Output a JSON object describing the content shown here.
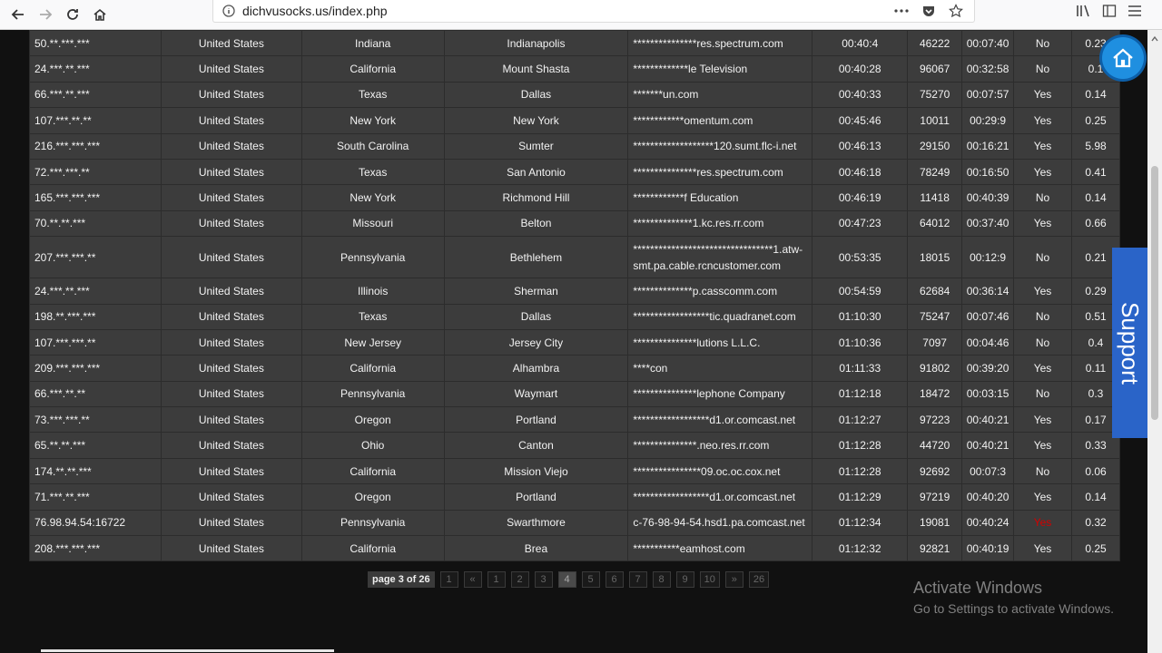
{
  "browser": {
    "url": "dichvusocks.us/index.php"
  },
  "rows": [
    [
      "50.**.***.***",
      "United States",
      "Indiana",
      "Indianapolis",
      "***************res.spectrum.com",
      "00:40:4",
      "46222",
      "00:07:40",
      "No",
      "0.23"
    ],
    [
      "24.***.**.***",
      "United States",
      "California",
      "Mount Shasta",
      "*************le Television",
      "00:40:28",
      "96067",
      "00:32:58",
      "No",
      "0.1"
    ],
    [
      "66.***.**.***",
      "United States",
      "Texas",
      "Dallas",
      "*******un.com",
      "00:40:33",
      "75270",
      "00:07:57",
      "Yes",
      "0.14"
    ],
    [
      "107.***.**.**",
      "United States",
      "New York",
      "New York",
      "************omentum.com",
      "00:45:46",
      "10011",
      "00:29:9",
      "Yes",
      "0.25"
    ],
    [
      "216.***.***.***",
      "United States",
      "South Carolina",
      "Sumter",
      "*******************120.sumt.flc-i.net",
      "00:46:13",
      "29150",
      "00:16:21",
      "Yes",
      "5.98"
    ],
    [
      "72.***.***.**",
      "United States",
      "Texas",
      "San Antonio",
      "***************res.spectrum.com",
      "00:46:18",
      "78249",
      "00:16:50",
      "Yes",
      "0.41"
    ],
    [
      "165.***.***.***",
      "United States",
      "New York",
      "Richmond Hill",
      "************f Education",
      "00:46:19",
      "11418",
      "00:40:39",
      "No",
      "0.14"
    ],
    [
      "70.**.**.***",
      "United States",
      "Missouri",
      "Belton",
      "**************1.kc.res.rr.com",
      "00:47:23",
      "64012",
      "00:37:40",
      "Yes",
      "0.66"
    ],
    [
      "207.***.***.**",
      "United States",
      "Pennsylvania",
      "Bethlehem",
      "*********************************1.atw-smt.pa.cable.rcncustomer.com",
      "00:53:35",
      "18015",
      "00:12:9",
      "No",
      "0.21"
    ],
    [
      "24.***.**.***",
      "United States",
      "Illinois",
      "Sherman",
      "**************p.casscomm.com",
      "00:54:59",
      "62684",
      "00:36:14",
      "Yes",
      "0.29"
    ],
    [
      "198.**.***.***",
      "United States",
      "Texas",
      "Dallas",
      "******************tic.quadranet.com",
      "01:10:30",
      "75247",
      "00:07:46",
      "No",
      "0.51"
    ],
    [
      "107.***.***.**",
      "United States",
      "New Jersey",
      "Jersey City",
      "***************lutions L.L.C.",
      "01:10:36",
      "7097",
      "00:04:46",
      "No",
      "0.4"
    ],
    [
      "209.***.***.***",
      "United States",
      "California",
      "Alhambra",
      "****con",
      "01:11:33",
      "91802",
      "00:39:20",
      "Yes",
      "0.11"
    ],
    [
      "66.***.**.**",
      "United States",
      "Pennsylvania",
      "Waymart",
      "***************lephone Company",
      "01:12:18",
      "18472",
      "00:03:15",
      "No",
      "0.3"
    ],
    [
      "73.***.***.**",
      "United States",
      "Oregon",
      "Portland",
      "******************d1.or.comcast.net",
      "01:12:27",
      "97223",
      "00:40:21",
      "Yes",
      "0.17"
    ],
    [
      "65.**.**.***",
      "United States",
      "Ohio",
      "Canton",
      "***************.neo.res.rr.com",
      "01:12:28",
      "44720",
      "00:40:21",
      "Yes",
      "0.33"
    ],
    [
      "174.**.**.***",
      "United States",
      "California",
      "Mission Viejo",
      "****************09.oc.oc.cox.net",
      "01:12:28",
      "92692",
      "00:07:3",
      "No",
      "0.06"
    ],
    [
      "71.***.**.***",
      "United States",
      "Oregon",
      "Portland",
      "******************d1.or.comcast.net",
      "01:12:29",
      "97219",
      "00:40:20",
      "Yes",
      "0.14"
    ],
    [
      "76.98.94.54:16722",
      "United States",
      "Pennsylvania",
      "Swarthmore",
      "c-76-98-94-54.hsd1.pa.comcast.net",
      "01:12:34",
      "19081",
      "00:40:24",
      "Yes",
      "0.32"
    ],
    [
      "208.***.***.***",
      "United States",
      "California",
      "Brea",
      "***********eamhost.com",
      "01:12:32",
      "92821",
      "00:40:19",
      "Yes",
      "0.25"
    ]
  ],
  "pagination": {
    "label": "page 3 of 26",
    "items": [
      "1",
      "«",
      "1",
      "2",
      "3",
      "4",
      "5",
      "6",
      "7",
      "8",
      "9",
      "10",
      "»",
      "26"
    ],
    "active": "4"
  },
  "support_label": "Support",
  "activate": {
    "title": "Activate Windows",
    "subtitle": "Go to Settings to activate Windows."
  },
  "colors": {
    "accent": "#1f8fe0",
    "support": "#2a64c8",
    "highlight": "#d40000"
  }
}
